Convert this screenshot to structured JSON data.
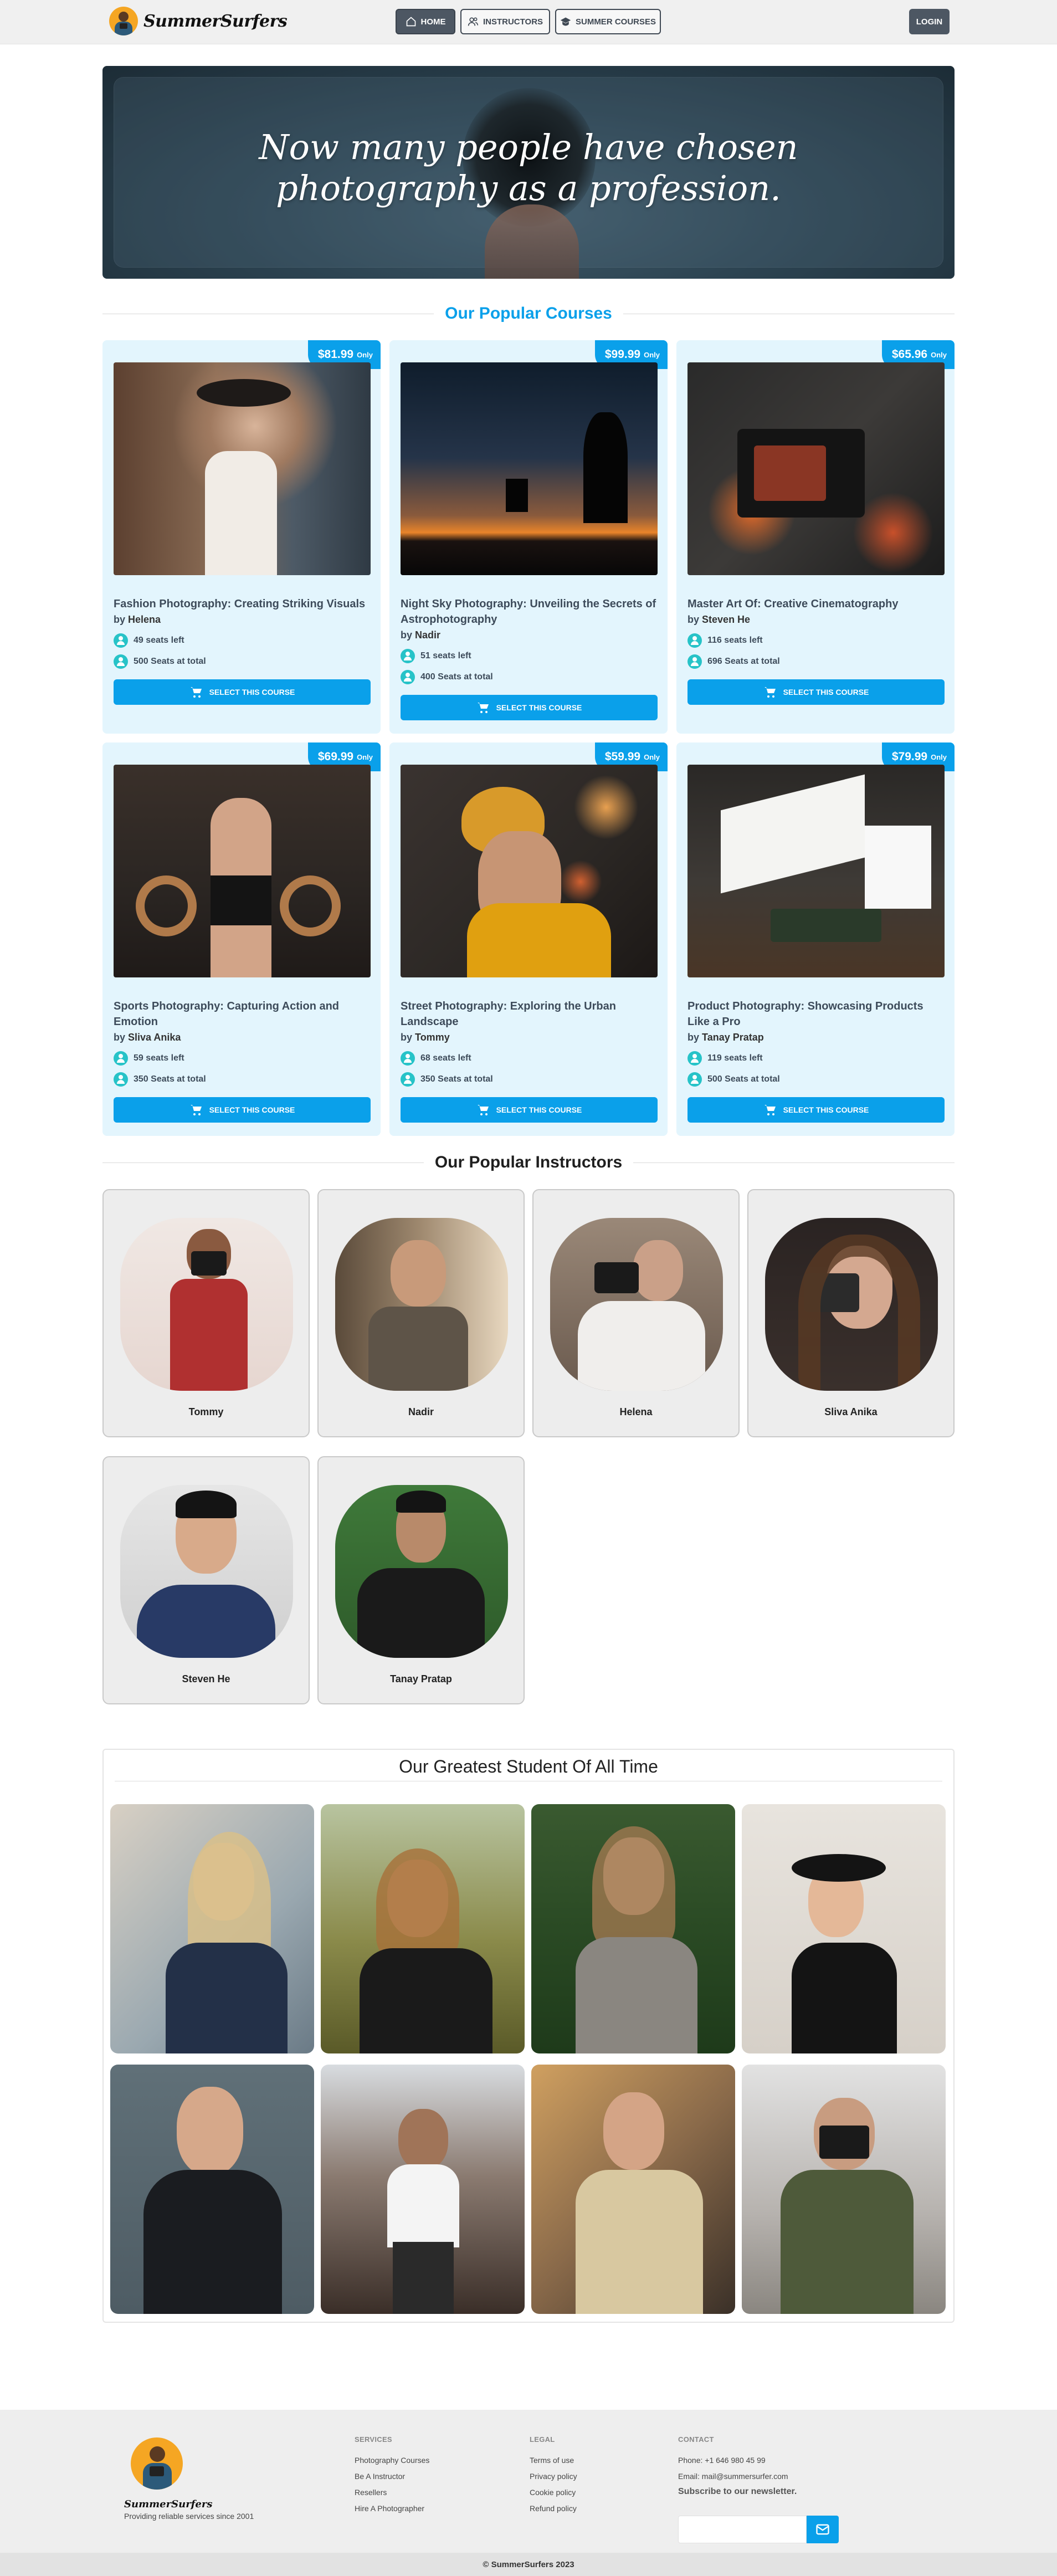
{
  "nav": {
    "brand": "SummerSurfers",
    "home": "Home",
    "instructors": "Instructors",
    "courses": "Summer Courses",
    "login": "Login"
  },
  "hero": {
    "title": "Now many people have chosen photography as a profession."
  },
  "courses_section": {
    "title": "Our Popular Courses"
  },
  "courses": [
    {
      "price": "$81.99",
      "only": "Only",
      "title": "Fashion Photography: Creating Striking Visuals",
      "by": "by",
      "instructor": "Helena",
      "seats_left": "49",
      "seats_left_label": "seats left",
      "seats_total": "500",
      "seats_total_label": "Seats at total",
      "button": "Select this course"
    },
    {
      "price": "$99.99",
      "only": "Only",
      "title": "Night Sky Photography: Unveiling the Secrets of Astrophotography",
      "by": "by",
      "instructor": "Nadir",
      "seats_left": "51",
      "seats_left_label": "seats left",
      "seats_total": "400",
      "seats_total_label": "Seats at total",
      "button": "Select this course"
    },
    {
      "price": "$65.96",
      "only": "Only",
      "title": "Master Art Of: Creative Cinematography",
      "by": "by",
      "instructor": "Steven He",
      "seats_left": "116",
      "seats_left_label": "seats left",
      "seats_total": "696",
      "seats_total_label": "Seats at total",
      "button": "Select this course"
    },
    {
      "price": "$69.99",
      "only": "Only",
      "title": "Sports Photography: Capturing Action and Emotion",
      "by": "by",
      "instructor": "Sliva Anika",
      "seats_left": "59",
      "seats_left_label": "seats left",
      "seats_total": "350",
      "seats_total_label": "Seats at total",
      "button": "Select this course"
    },
    {
      "price": "$59.99",
      "only": "Only",
      "title": "Street Photography: Exploring the Urban Landscape",
      "by": "by",
      "instructor": "Tommy",
      "seats_left": "68",
      "seats_left_label": "seats left",
      "seats_total": "350",
      "seats_total_label": "Seats at total",
      "button": "Select this course"
    },
    {
      "price": "$79.99",
      "only": "Only",
      "title": "Product Photography: Showcasing Products Like a Pro",
      "by": "by",
      "instructor": "Tanay Pratap",
      "seats_left": "119",
      "seats_left_label": "seats left",
      "seats_total": "500",
      "seats_total_label": "Seats at total",
      "button": "Select this course"
    }
  ],
  "instructors_section": {
    "title": "Our Popular Instructors"
  },
  "instructors": [
    {
      "name": "Tommy"
    },
    {
      "name": "Nadir"
    },
    {
      "name": "Helena"
    },
    {
      "name": "Sliva Anika"
    },
    {
      "name": "Steven He"
    },
    {
      "name": "Tanay Pratap"
    }
  ],
  "students_section": {
    "title": "Our Greatest Student Of All Time"
  },
  "footer": {
    "brand": "SummerSurfers",
    "tagline": "Providing reliable services since 2001",
    "services": {
      "title": "Services",
      "links": [
        "Photography Courses",
        "Be A Instructor",
        "Resellers",
        "Hire A Photographer"
      ]
    },
    "legal": {
      "title": "Legal",
      "links": [
        "Terms of use",
        "Privacy policy",
        "Cookie policy",
        "Refund policy"
      ]
    },
    "contact": {
      "title": "Contact",
      "phone": "Phone: +1 646 980 45 99",
      "email": "Email: mail@summersurfer.com",
      "subscribe": "Subscribe to our newsletter."
    },
    "copyright": "© SummerSurfers 2023"
  },
  "colors": {
    "accent": "#0aa0ea",
    "card_bg": "#e3f5fd",
    "nav_dark": "#4d5763",
    "seat_icon": "#27c3c8"
  }
}
